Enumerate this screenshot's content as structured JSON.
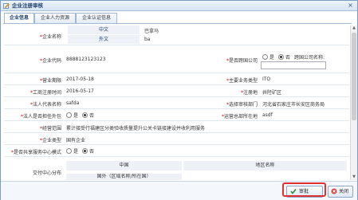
{
  "window": {
    "title": "企业注册审核",
    "close_glyph": "×"
  },
  "tabs": [
    {
      "label": "企业信息"
    },
    {
      "label": "企业人力资源"
    },
    {
      "label": "企业认证信息"
    }
  ],
  "form": {
    "company_name_label": "企业名称",
    "chinese_label": "中文",
    "chinese_value": "巴拿马",
    "english_label": "外文",
    "english_value": "ba",
    "company_code_label": "企业代码",
    "company_code_value": "8888123123123",
    "foreign_label": "是否跨国公司",
    "yes": "是",
    "no": "否",
    "foreign_name_label": "跨国公司名称:",
    "business_term_label": "营业期限",
    "business_term_value": "2017-05-18",
    "main_service_label": "主要业务类型",
    "main_service_value": "ITO",
    "reg_date_label": "工商注册时间",
    "reg_date_value": "2016-05-17",
    "reg_area_label": "注册地",
    "reg_area_value": "井陉矿区",
    "legal_rep_label": "法人代表名称",
    "legal_rep_value": "safda",
    "select_area_label": "选择审核部门",
    "select_area_value": "河北省石家庄市长安区商务局",
    "legal_outsource_label": "法人是否担任外包",
    "hq_city_label": "运营总部所在地",
    "hq_city_value": "asdf",
    "scope_label": "经营范围",
    "scope_value": "累计接受行福建区分类验收质量提升公关卡链接建设并收利用服务",
    "company_type_label": "企业类型",
    "company_type_value": "国有企业",
    "shared_center_label": "是否共享服务中心模式",
    "delivery_label": "交付中心分布",
    "grid_col1": "中国",
    "grid_col2": "地区名称",
    "grid_row_partial": "国外（区域名称/所在国）"
  },
  "footer": {
    "approve_label": "审批",
    "close_label": "关闭"
  },
  "colors": {
    "accent": "#1e3f6e",
    "required": "#d40000",
    "highlight": "#e03030"
  }
}
